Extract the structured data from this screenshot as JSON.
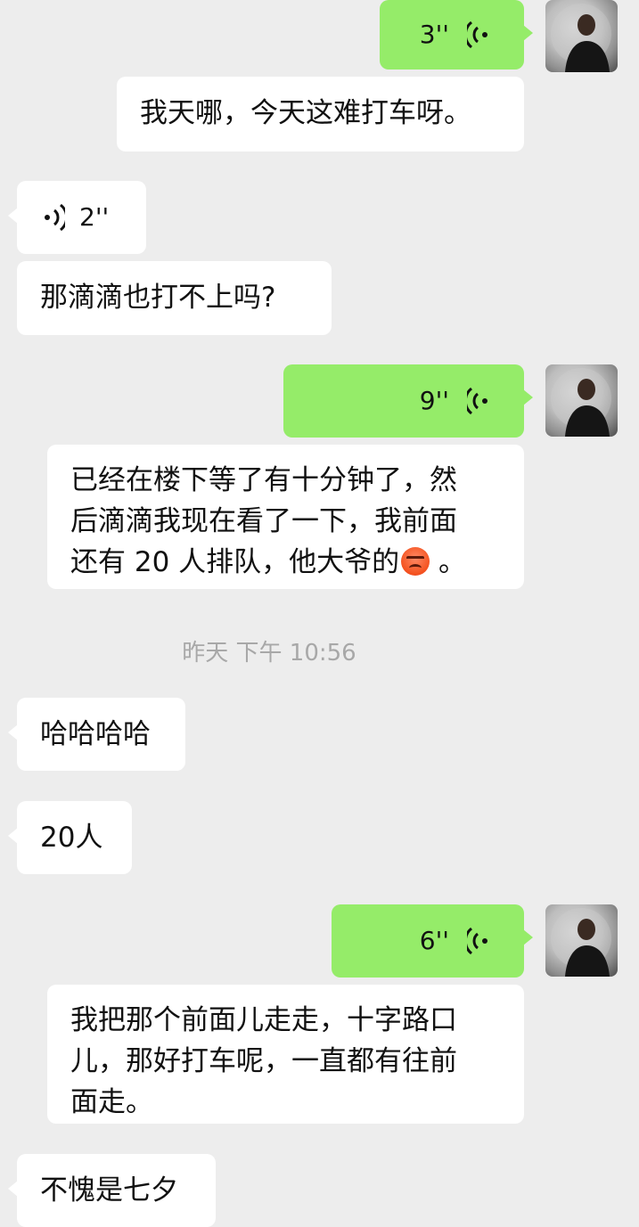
{
  "messages": [
    {
      "side": "right",
      "type": "voice",
      "duration": "3''"
    },
    {
      "side": "right",
      "type": "text",
      "text": "我天哪，今天这难打车呀。"
    },
    {
      "side": "left",
      "type": "voice",
      "duration": "2''"
    },
    {
      "side": "left",
      "type": "text",
      "text": "那滴滴也打不上吗?"
    },
    {
      "side": "right",
      "type": "voice",
      "duration": "9''"
    },
    {
      "side": "right",
      "type": "text",
      "lines": [
        "已经在楼下等了有十分钟了，然",
        "后滴滴我现在看了一下，我前面",
        "还有 20 人排队，他大爷的"
      ],
      "emoji": "angry-face",
      "trailing": " 。"
    },
    {
      "type": "timestamp",
      "text": "昨天 下午 10:56"
    },
    {
      "side": "left",
      "type": "text",
      "text": "哈哈哈哈"
    },
    {
      "side": "left",
      "type": "text",
      "text": "20人"
    },
    {
      "side": "right",
      "type": "voice",
      "duration": "6''"
    },
    {
      "side": "right",
      "type": "text",
      "lines": [
        "我把那个前面儿走走，十字路口",
        "儿，那好打车呢，一直都有往前",
        "面走。"
      ]
    },
    {
      "side": "left",
      "type": "text",
      "text": "不愧是七夕"
    }
  ],
  "colors": {
    "background": "#ededed",
    "sent_bubble": "#95ec69",
    "received_bubble": "#ffffff",
    "timestamp_text": "#a8a8a8"
  },
  "icons": {
    "voice_sent": "voice-wave-icon",
    "voice_received": "voice-wave-icon",
    "avatar": "user-avatar"
  }
}
